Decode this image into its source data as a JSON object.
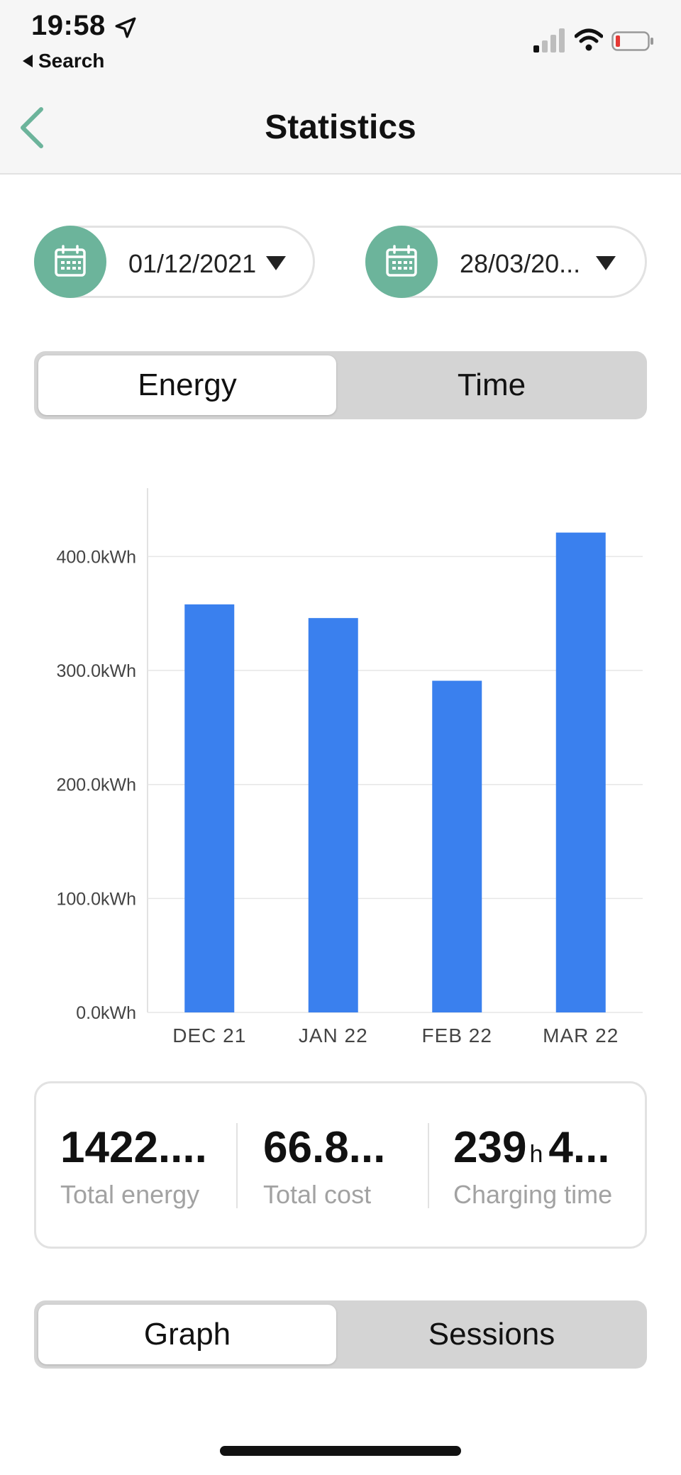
{
  "status_bar": {
    "time": "19:58",
    "back_label": "Search"
  },
  "nav": {
    "title": "Statistics"
  },
  "date_range": {
    "start": "01/12/2021",
    "end": "28/03/20..."
  },
  "metric_tabs": {
    "items": [
      "Energy",
      "Time"
    ],
    "selected": "Energy"
  },
  "chart_data": {
    "type": "bar",
    "categories": [
      "DEC 21",
      "JAN 22",
      "FEB 22",
      "MAR 22"
    ],
    "values": [
      358,
      346,
      291,
      421
    ],
    "yticks": [
      "0.0kWh",
      "100.0kWh",
      "200.0kWh",
      "300.0kWh",
      "400.0kWh"
    ],
    "ylim": [
      0,
      460
    ],
    "grid": true,
    "bar_color": "#3a80ee"
  },
  "summary": {
    "energy_value": "1422....",
    "energy_label": "Total energy",
    "cost_value": "66.8...",
    "cost_label": "Total cost",
    "charging_hours": "239",
    "charging_hours_unit": "h",
    "charging_minutes": "4...",
    "charging_label": "Charging time"
  },
  "view_tabs": {
    "items": [
      "Graph",
      "Sessions"
    ],
    "selected": "Graph"
  },
  "colors": {
    "accent": "#6cb49b",
    "bar": "#3a80ee",
    "segment_bg": "#d4d4d4"
  }
}
